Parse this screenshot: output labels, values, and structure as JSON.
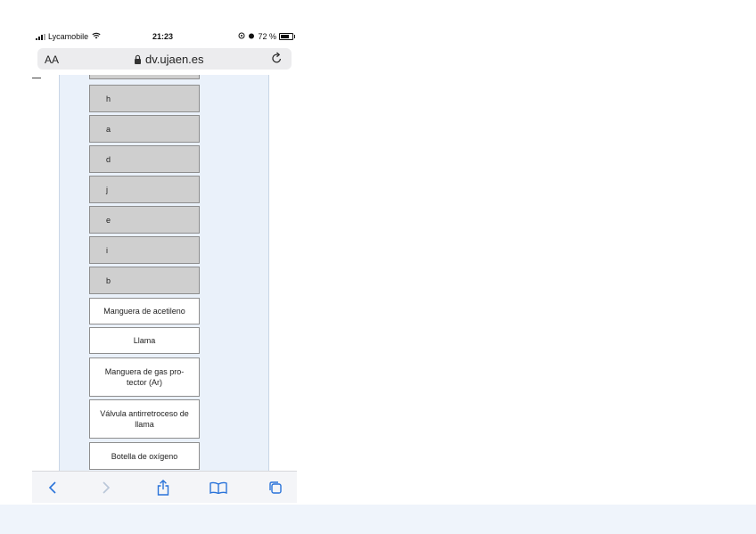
{
  "status_bar": {
    "carrier": "Lycamobile",
    "time": "21:23",
    "battery_percent": "72 %",
    "battery_level": 0.72
  },
  "url_bar": {
    "text_size_label": "AA",
    "url": "dv.ujaen.es"
  },
  "tiles": [
    {
      "label": "h"
    },
    {
      "label": "a"
    },
    {
      "label": "d"
    },
    {
      "label": "j"
    },
    {
      "label": "e"
    },
    {
      "label": "i"
    },
    {
      "label": "b"
    },
    {
      "label": "Manguera de acetileno"
    },
    {
      "label": "Llama"
    },
    {
      "label": "Manguera de gas pro-tector (Ar)"
    },
    {
      "label": "Válvula antirretroceso de llama"
    },
    {
      "label": "Botella de oxígeno"
    }
  ],
  "colors": {
    "tile_gray": "#cfcfcf",
    "panel_bg": "#eaf1fa",
    "accent": "#2a73d9"
  },
  "icons": {
    "back": "chevron-left-icon",
    "forward": "chevron-right-icon",
    "share": "share-icon",
    "bookmarks": "book-icon",
    "tabs": "tabs-icon"
  }
}
